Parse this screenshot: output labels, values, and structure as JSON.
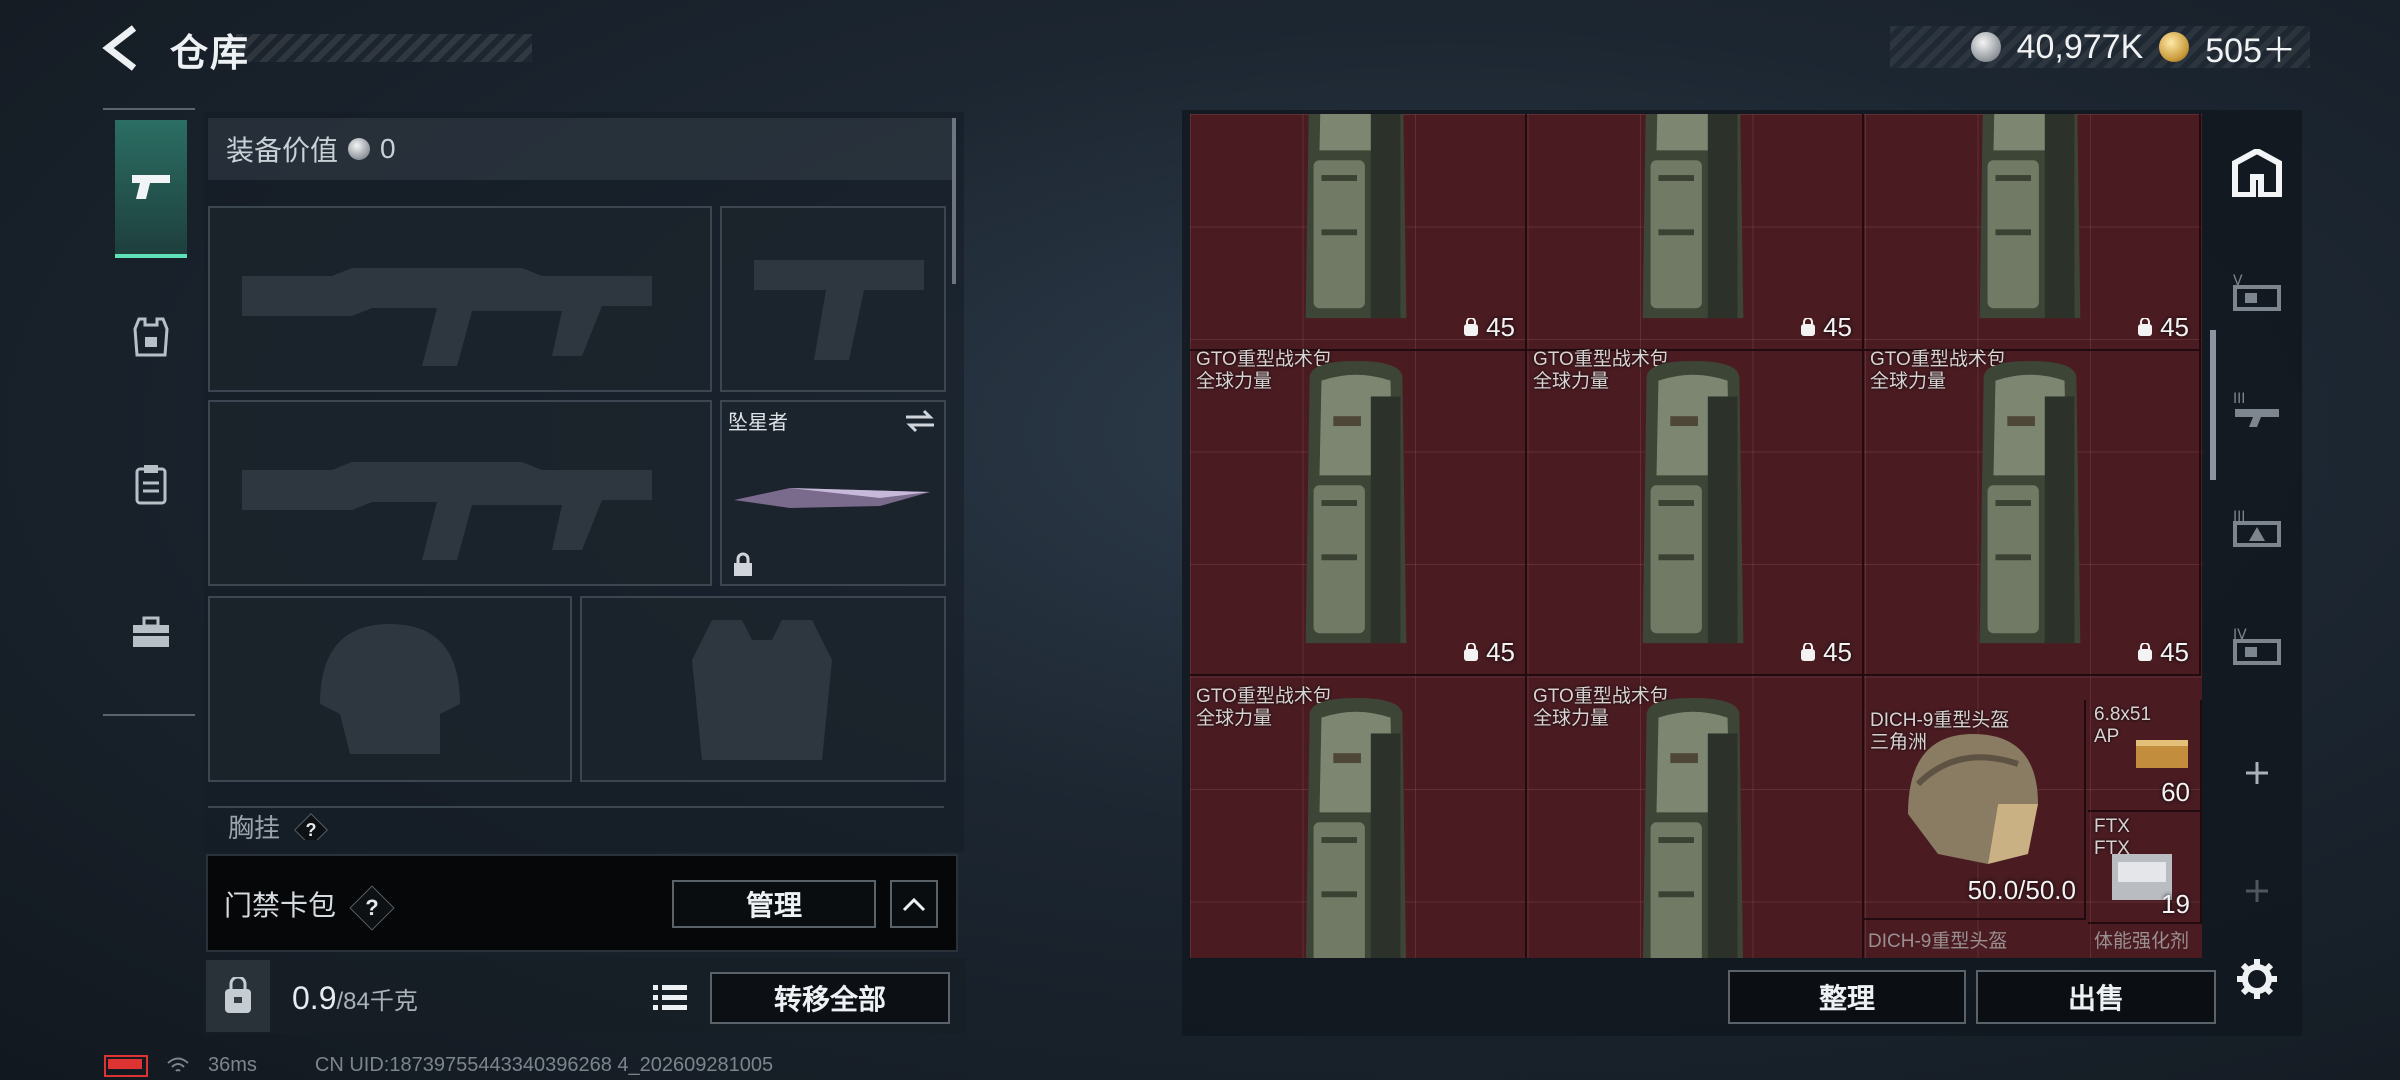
{
  "header": {
    "title": "仓库",
    "currency_1": "40,977K",
    "currency_2": "505＋"
  },
  "leftnav": {
    "items": [
      "pistol-icon",
      "armor-rig-icon",
      "clipboard-icon",
      "toolbox-icon"
    ],
    "active_index": 0
  },
  "loadout": {
    "equip_value_label": "装备价值",
    "equip_value": "0",
    "melee_name": "坠星者",
    "badge_label": "胸挂",
    "badge_help": "?",
    "keycard_label": "门禁卡包",
    "keycard_help": "?",
    "manage_button": "管理",
    "weight_value": "0.9",
    "weight_total": "/84千克",
    "transfer_all_button": "转移全部"
  },
  "stash": {
    "items": [
      {
        "name": "",
        "sub": "",
        "count": "45"
      },
      {
        "name": "",
        "sub": "",
        "count": "45"
      },
      {
        "name": "",
        "sub": "",
        "count": "45"
      },
      {
        "name": "GTO重型战术包",
        "sub": "全球力量",
        "count": "45"
      },
      {
        "name": "GTO重型战术包",
        "sub": "全球力量",
        "count": "45"
      },
      {
        "name": "GTO重型战术包",
        "sub": "全球力量",
        "count": "45"
      },
      {
        "name": "GTO重型战术包",
        "sub": "全球力量",
        "count": ""
      },
      {
        "name": "GTO重型战术包",
        "sub": "全球力量",
        "count": ""
      }
    ],
    "helmet": {
      "name": "DICH-9重型头盔",
      "sub": "三角洲",
      "durability": "50.0/50.0"
    },
    "helmet_2_partial": "DICH-9重型头盔",
    "ammo": {
      "name": "6.8x51",
      "sub": "AP",
      "count": "60"
    },
    "ftx": {
      "name": "FTX",
      "sub": "FTX",
      "count": "19"
    },
    "bottom_partial": "体能强化剂",
    "sort_button": "整理",
    "sell_button": "出售"
  },
  "sidetabs": [
    "home-shelf-icon",
    "tier-V-shelf-icon",
    "tier-III-shelf-icon",
    "tier-III-warning-shelf-icon",
    "tier-IV-shelf-icon",
    "add-icon",
    "add-icon-disabled"
  ],
  "status": {
    "ping": "36ms",
    "uid": "CN UID:18739755443340396268 4_202609281005"
  },
  "colors": {
    "accent": "#5fe0b8",
    "stash_bg": "#4a1c22"
  }
}
